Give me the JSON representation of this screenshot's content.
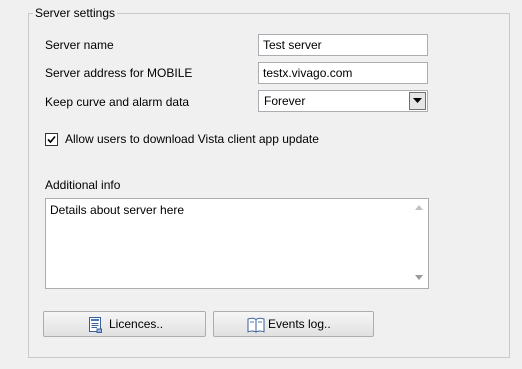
{
  "settings": {
    "group_title": "Server settings",
    "server_name": {
      "label": "Server name",
      "value": "Test server"
    },
    "server_address": {
      "label": "Server address for MOBILE",
      "value": "testx.vivago.com"
    },
    "keep_data": {
      "label": "Keep curve and alarm data",
      "selected": "Forever"
    },
    "allow_update": {
      "label": "Allow users to download Vista client app update",
      "checked": true
    },
    "additional_info": {
      "label": "Additional info",
      "value": "Details about server here"
    }
  },
  "buttons": {
    "licences_label": "Licences..",
    "events_log_label": "Events log.."
  },
  "icons": {
    "licences": "document-icon",
    "events_log": "book-icon",
    "dropdown": "chevron-down-icon"
  }
}
